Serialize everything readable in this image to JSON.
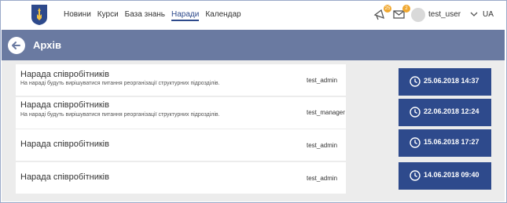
{
  "nav": {
    "items": [
      {
        "label": "Новини",
        "active": false
      },
      {
        "label": "Курси",
        "active": false
      },
      {
        "label": "База знань",
        "active": false
      },
      {
        "label": "Наради",
        "active": true
      },
      {
        "label": "Календар",
        "active": false
      }
    ]
  },
  "user": {
    "notifications_count": "25",
    "messages_count": "2",
    "name": "test_user",
    "language": "UA"
  },
  "header": {
    "title": "Архів"
  },
  "meetings": [
    {
      "title": "Нарада співробітників",
      "description": "На нараді будуть вирішуватися питання реорганізації структурних підрозділів.",
      "author": "test_admin",
      "date": "25.06.2018 14:37"
    },
    {
      "title": "Нарада співробітників",
      "description": "На нараді будуть вирішуватися питання реорганізації структурних підрозділів.",
      "author": "test_manager",
      "date": "22.06.2018 12:24"
    },
    {
      "title": "Нарада співробітників",
      "description": "",
      "author": "test_admin",
      "date": "15.06.2018 17:27"
    },
    {
      "title": "Нарада співробітників",
      "description": "",
      "author": "test_admin",
      "date": "14.06.2018 09:40"
    }
  ],
  "colors": {
    "accent": "#2e4a8c",
    "header_band": "#6a7aa1",
    "badge": "#f0a830"
  }
}
